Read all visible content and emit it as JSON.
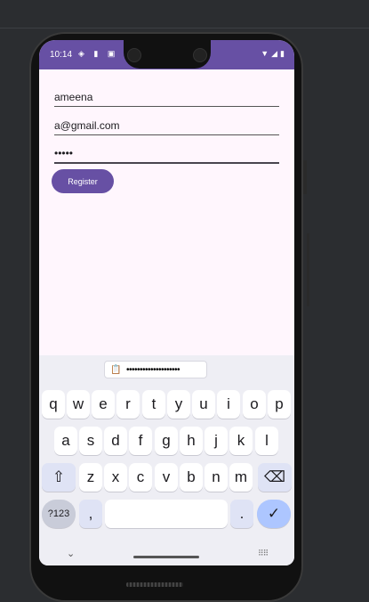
{
  "status": {
    "time": "10:14",
    "left_icons": "◈ ▮ ▣",
    "right_icons": "▼◢▮"
  },
  "form": {
    "name_value": "ameena",
    "email_value": "a@gmail.com",
    "password_value": "•••••",
    "register_label": "Register"
  },
  "keyboard": {
    "clipboard_text": "••••••••••••••••••••",
    "row1": [
      "q",
      "w",
      "e",
      "r",
      "t",
      "y",
      "u",
      "i",
      "o",
      "p"
    ],
    "row2": [
      "a",
      "s",
      "d",
      "f",
      "g",
      "h",
      "j",
      "k",
      "l"
    ],
    "row3": [
      "z",
      "x",
      "c",
      "v",
      "b",
      "n",
      "m"
    ],
    "shift": "⇧",
    "backspace": "⌫",
    "symbols": "?123",
    "comma": ",",
    "period": ".",
    "enter": "✓",
    "hide": "⌄",
    "grid": "⠿⠿"
  }
}
